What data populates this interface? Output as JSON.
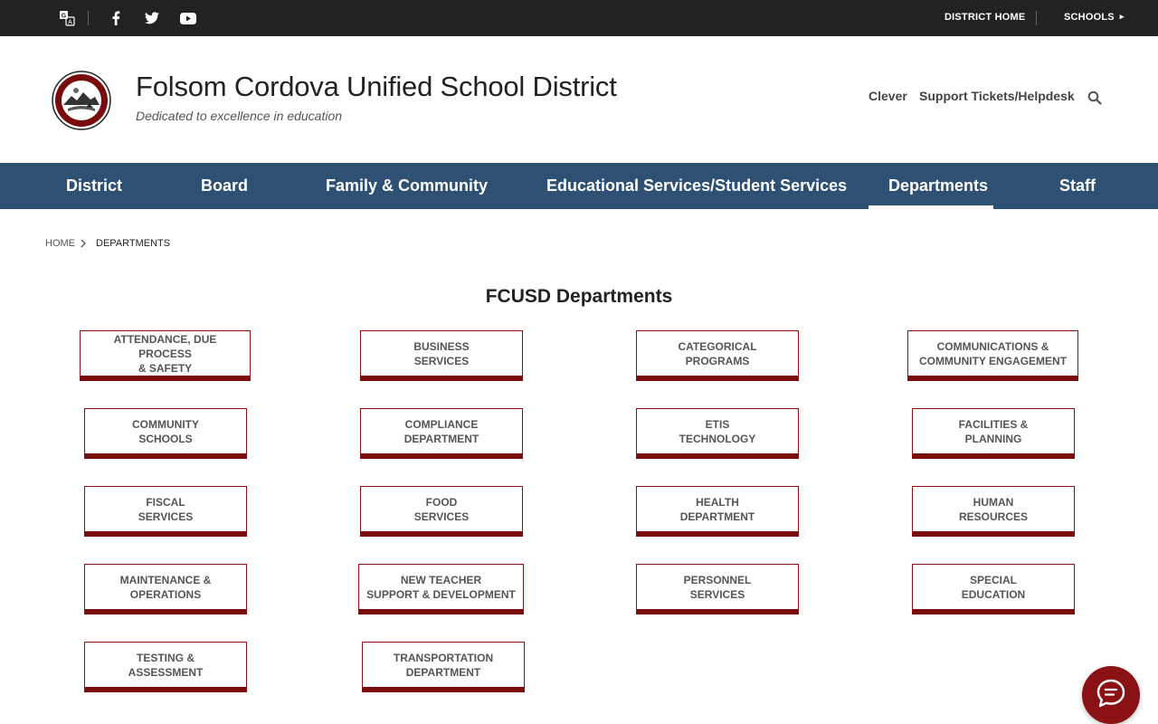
{
  "topbar": {
    "icons": [
      "translate-icon",
      "facebook-icon",
      "twitter-icon",
      "youtube-icon"
    ],
    "district_home": "DISTRICT HOME",
    "schools": "SCHOOLS"
  },
  "header": {
    "title": "Folsom Cordova Unified School District",
    "tagline": "Dedicated to excellence in education",
    "links": [
      "Clever",
      "Support Tickets/Helpdesk"
    ],
    "search_icon": "search-icon"
  },
  "nav": {
    "items": [
      "District",
      "Board",
      "Family & Community",
      "Educational Services/Student Services",
      "Departments",
      "Staff"
    ],
    "active": "Departments"
  },
  "breadcrumb": {
    "home": "HOME",
    "current": "DEPARTMENTS"
  },
  "page_title": "FCUSD Departments",
  "departments": [
    "ATTENDANCE, DUE PROCESS\n& SAFETY",
    "BUSINESS\nSERVICES",
    "CATEGORICAL\nPROGRAMS",
    "COMMUNICATIONS &\nCOMMUNITY ENGAGEMENT",
    "COMMUNITY\nSCHOOLS",
    "COMPLIANCE\nDEPARTMENT",
    "ETIS\nTECHNOLOGY",
    "FACILITIES &\nPLANNING",
    "FISCAL\nSERVICES",
    "FOOD\nSERVICES",
    "HEALTH\nDEPARTMENT",
    "HUMAN\nRESOURCES",
    "MAINTENANCE &\nOPERATIONS",
    "NEW TEACHER\nSUPPORT & DEVELOPMENT",
    "PERSONNEL\nSERVICES",
    "SPECIAL\nEDUCATION",
    "TESTING &\nASSESSMENT",
    "TRANSPORTATION\nDEPARTMENT"
  ],
  "colors": {
    "topbar": "#222222",
    "nav": "#2e5073",
    "accent": "#7a0c0e"
  },
  "chat_icon": "chat-icon"
}
